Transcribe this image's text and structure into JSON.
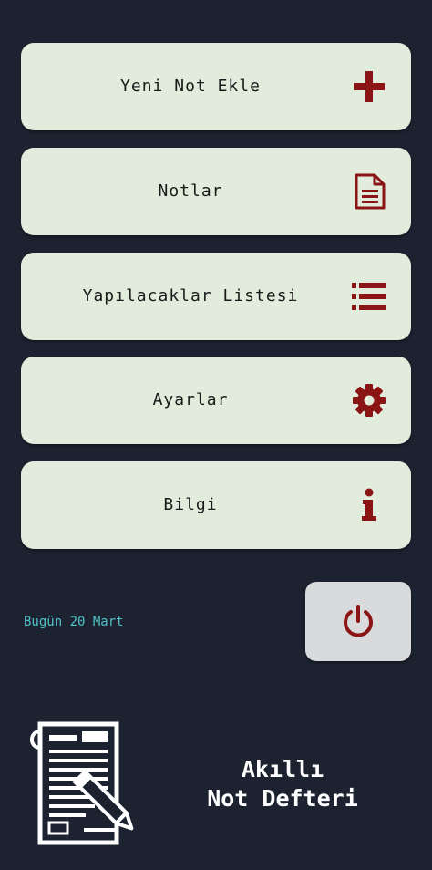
{
  "menu": [
    {
      "label": "Yeni Not Ekle",
      "icon": "plus-icon"
    },
    {
      "label": "Notlar",
      "icon": "document-icon"
    },
    {
      "label": "Yapılacaklar Listesi",
      "icon": "list-icon"
    },
    {
      "label": "Ayarlar",
      "icon": "gear-icon"
    },
    {
      "label": "Bilgi",
      "icon": "info-icon"
    }
  ],
  "footer": {
    "date_text": "Bugün 20 Mart",
    "power_icon": "power-icon"
  },
  "branding": {
    "title_line1": "Akıllı",
    "title_line2": "Not Defteri",
    "logo_icon": "notepad-pen-icon"
  },
  "colors": {
    "background": "#1c2230",
    "button": "#e1ecdc",
    "accent": "#8b1414",
    "date_text": "#4fc3c9",
    "power_button": "#d9dadc"
  }
}
